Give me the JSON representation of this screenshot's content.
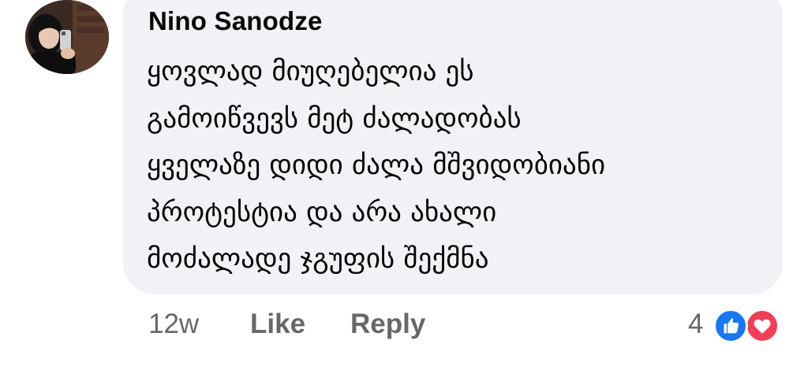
{
  "comment": {
    "author": "Nino Sanodze",
    "lines": [
      "ყოვლად მიუღებელია ეს",
      "გამოიწვევს მეტ ძალადობას",
      "ყველაზე დიდი ძალა მშვიდობიანი",
      "პროტესტია და არა ახალი",
      "მოძალადე ჯგუფის შექმნა"
    ],
    "timestamp": "12w",
    "like_label": "Like",
    "reply_label": "Reply",
    "reaction_count": "4",
    "reactions": [
      "like-icon",
      "love-icon"
    ]
  },
  "colors": {
    "bubble": "#f0f2f5",
    "text": "#050505",
    "secondary_text": "#65676b",
    "like_blue": "#1877f2",
    "love_red": "#f33e58"
  }
}
